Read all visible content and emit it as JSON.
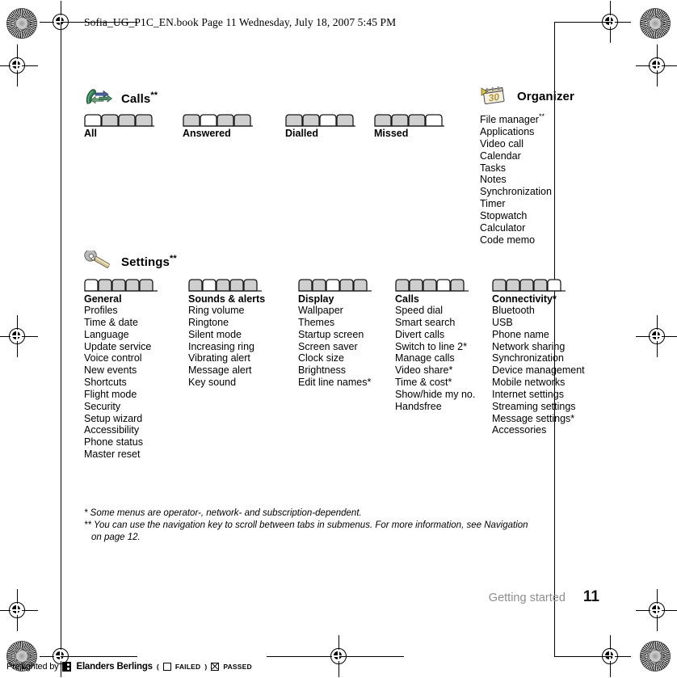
{
  "document": {
    "header_line": "Sofia_UG_P1C_EN.book  Page 11  Wednesday, July 18, 2007  5:45 PM",
    "footer_section": "Getting started",
    "footer_page": "11"
  },
  "groups": [
    {
      "id": "calls",
      "icon": "calls-icon",
      "title": "Calls",
      "title_marker": "**",
      "tab_count": 4,
      "tabs": [
        {
          "label": "All",
          "active_index": 1
        },
        {
          "label": "Answered",
          "active_index": 2
        },
        {
          "label": "Dialled",
          "active_index": 3
        },
        {
          "label": "Missed",
          "active_index": 4
        }
      ]
    },
    {
      "id": "organizer",
      "icon": "organizer-icon",
      "title": "Organizer",
      "title_marker": "",
      "items": [
        {
          "label": "File manager",
          "marker": "**"
        },
        {
          "label": "Applications",
          "marker": ""
        },
        {
          "label": "Video call",
          "marker": ""
        },
        {
          "label": "Calendar",
          "marker": ""
        },
        {
          "label": "Tasks",
          "marker": ""
        },
        {
          "label": "Notes",
          "marker": ""
        },
        {
          "label": "Synchronization",
          "marker": ""
        },
        {
          "label": "Timer",
          "marker": ""
        },
        {
          "label": "Stopwatch",
          "marker": ""
        },
        {
          "label": "Calculator",
          "marker": ""
        },
        {
          "label": "Code memo",
          "marker": ""
        }
      ]
    },
    {
      "id": "settings",
      "icon": "settings-icon",
      "title": "Settings",
      "title_marker": "**",
      "tab_count": 5,
      "columns": [
        {
          "head": "General",
          "head_marker": "",
          "active_index": 1,
          "items": [
            "Profiles",
            "Time & date",
            "Language",
            "Update service",
            "Voice control",
            "New events",
            "Shortcuts",
            "Flight mode",
            "Security",
            "Setup wizard",
            "Accessibility",
            "Phone status",
            "Master reset"
          ]
        },
        {
          "head": "Sounds & alerts",
          "head_marker": "",
          "active_index": 2,
          "items": [
            "Ring volume",
            "Ringtone",
            "Silent mode",
            "Increasing ring",
            "Vibrating alert",
            "Message alert",
            "Key sound"
          ]
        },
        {
          "head": "Display",
          "head_marker": "",
          "active_index": 3,
          "items": [
            "Wallpaper",
            "Themes",
            "Startup screen",
            "Screen saver",
            "Clock size",
            "Brightness",
            "Edit line names*"
          ]
        },
        {
          "head": "Calls",
          "head_marker": "",
          "active_index": 4,
          "items": [
            "Speed dial",
            "Smart search",
            "Divert calls",
            "Switch to line 2*",
            "Manage calls",
            "Video share*",
            "Time & cost*",
            "Show/hide my no.",
            "Handsfree"
          ]
        },
        {
          "head": "Connectivity*",
          "head_marker": "",
          "active_index": 5,
          "items": [
            "Bluetooth",
            "USB",
            "Phone name",
            "Network sharing",
            "Synchronization",
            "Device management",
            "Mobile networks",
            "Internet settings",
            "Streaming settings",
            "Message settings*",
            "Accessories"
          ]
        }
      ]
    }
  ],
  "footnotes": {
    "line1": "* Some menus are operator-, network- and subscription-dependent.",
    "line2": "** You can use the navigation key to scroll between tabs in submenus. For more information, see Navigation",
    "line3": "on page 12."
  },
  "preflight": {
    "prefix": "Preflighted by",
    "brand": "Elanders Berlings",
    "open_paren": "(",
    "failed_label": "FAILED",
    "close_paren": ")",
    "passed_label": "PASSED"
  },
  "colors": {
    "footer_section": "#8d8d8d",
    "tab_fill": "#cfcfcf",
    "tab_stroke": "#1a1a1a",
    "calls_icon_green": "#2f7a4f",
    "calls_icon_blue": "#4a5f9e",
    "organizer_icon_yellow": "#e0c060",
    "settings_icon_gray": "#9a9a9a"
  }
}
